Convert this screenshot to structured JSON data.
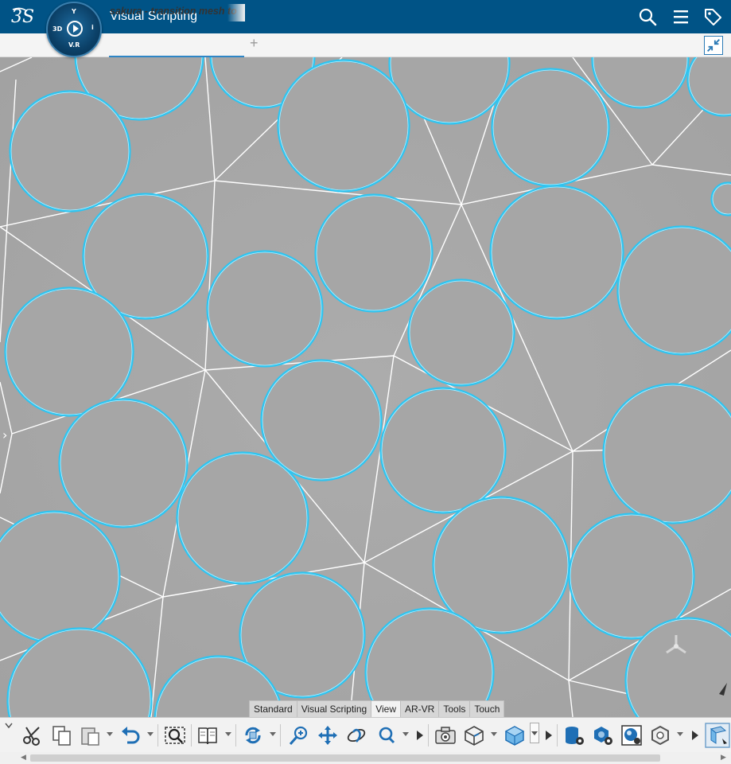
{
  "app": {
    "title": "Visual Scripting",
    "brand_logo": "3DS",
    "compass": {
      "top": "Y",
      "left": "3D",
      "right": "i",
      "bottom": "V.R"
    }
  },
  "header_icons": [
    "search-icon",
    "menu-icon",
    "tag-icon"
  ],
  "document_tab": {
    "label": "sakura - transition mesh to",
    "add_label": "+"
  },
  "ribbon": {
    "tabs": [
      {
        "label": "Standard",
        "active": false
      },
      {
        "label": "Visual Scripting",
        "active": false
      },
      {
        "label": "View",
        "active": true
      },
      {
        "label": "AR-VR",
        "active": false
      },
      {
        "label": "Tools",
        "active": false
      },
      {
        "label": "Touch",
        "active": false
      }
    ]
  },
  "toolbar_icons": [
    "cut-icon",
    "copy-icon",
    "paste-icon",
    "undo-icon",
    "zoom-area-icon",
    "book-icon",
    "rotate-icon",
    "zoom-in-icon",
    "pan-icon",
    "orbit-icon",
    "magnifier-icon",
    "capture-icon",
    "isometric-view-icon",
    "cube-view-icon",
    "database-gear-icon",
    "sphere-gear-icon",
    "render-icon",
    "hexagon-icon",
    "display-mode-icon"
  ],
  "colors": {
    "titlebar": "#005386",
    "circle_stroke": "#2ec4f0",
    "mesh_line": "#ffffff",
    "viewport_bg": "#a5a5a5",
    "accent": "#2f86c6"
  }
}
